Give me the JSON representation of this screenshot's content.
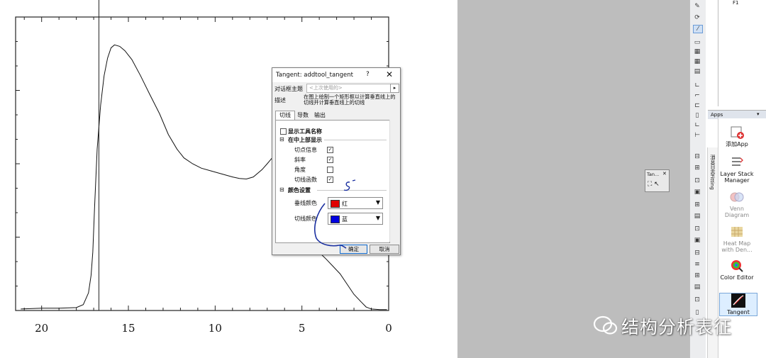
{
  "plot": {
    "x_tick_labels": [
      "20",
      "15",
      "10",
      "5",
      "0"
    ],
    "x_ticks": [
      20,
      15,
      10,
      5,
      0
    ],
    "xlim": [
      21.5,
      0
    ],
    "ylim": [
      0,
      1.0
    ],
    "vertical_line_x": 16.7,
    "curve": [
      [
        21.2,
        0.005
      ],
      [
        20,
        0.008
      ],
      [
        19,
        0.008
      ],
      [
        18,
        0.01
      ],
      [
        17.6,
        0.02
      ],
      [
        17.3,
        0.06
      ],
      [
        17.15,
        0.12
      ],
      [
        17.05,
        0.2
      ],
      [
        16.95,
        0.35
      ],
      [
        16.8,
        0.55
      ],
      [
        16.6,
        0.7
      ],
      [
        16.4,
        0.8
      ],
      [
        16.2,
        0.86
      ],
      [
        16.0,
        0.895
      ],
      [
        15.8,
        0.905
      ],
      [
        15.5,
        0.9
      ],
      [
        15.2,
        0.885
      ],
      [
        14.8,
        0.855
      ],
      [
        14.3,
        0.8
      ],
      [
        13.8,
        0.74
      ],
      [
        13.2,
        0.67
      ],
      [
        12.7,
        0.6
      ],
      [
        12.2,
        0.55
      ],
      [
        11.8,
        0.52
      ],
      [
        11.3,
        0.5
      ],
      [
        10.8,
        0.485
      ],
      [
        10.2,
        0.475
      ],
      [
        9.6,
        0.465
      ],
      [
        9.0,
        0.455
      ],
      [
        8.6,
        0.45
      ],
      [
        8.2,
        0.448
      ],
      [
        7.8,
        0.455
      ],
      [
        7.3,
        0.48
      ],
      [
        7.0,
        0.5
      ],
      [
        6.5,
        0.535
      ],
      [
        6.2,
        0.54
      ]
    ],
    "curve_tail": [
      [
        3.95,
        0.195
      ],
      [
        3.6,
        0.175
      ],
      [
        3.2,
        0.15
      ],
      [
        2.8,
        0.125
      ],
      [
        2.4,
        0.09
      ],
      [
        2.0,
        0.055
      ],
      [
        1.6,
        0.03
      ],
      [
        1.3,
        0.012
      ],
      [
        1.0,
        0.005
      ],
      [
        0.5,
        0.003
      ],
      [
        0.1,
        0.003
      ]
    ]
  },
  "dialog": {
    "title": "Tangent: addtool_tangent",
    "help": "?",
    "close": "✕",
    "theme_label": "对话框主题",
    "theme_value": "<上次使用的>",
    "theme_arrow": "▸",
    "desc_label": "描述",
    "desc_text": "在图上绘制一个矩形框以计算垂直线上的切线并计算垂直线上的切线",
    "tabs": [
      "切线",
      "导数",
      "输出"
    ],
    "show_tool_name": "显示工具名称",
    "group_display": "在中上部显示",
    "group_display_expander": "⊟",
    "options": [
      {
        "label": "切点信息",
        "checked": true
      },
      {
        "label": "斜率",
        "checked": true
      },
      {
        "label": "角度",
        "checked": false
      },
      {
        "label": "切线函数",
        "checked": true
      }
    ],
    "group_color": "颜色设置",
    "group_color_expander": "⊟",
    "vline_color_label": "垂线颜色",
    "vline_color_name": "红",
    "vline_color_hex": "#e00000",
    "tangent_color_label": "切线颜色",
    "tangent_color_name": "蓝",
    "tangent_color_hex": "#0000e0",
    "ok": "确定",
    "cancel": "取消"
  },
  "mini_window": {
    "title": "Tan...",
    "close": "✕",
    "icons": "⛶ ↖"
  },
  "apps": {
    "top_text": "F1",
    "header": "Apps",
    "menu": "▾",
    "side_tab_1": "消息日志",
    "side_tab_2": "Fitting",
    "items": [
      {
        "label": "添加App",
        "icon": "add-app-icon",
        "dim": false
      },
      {
        "label": "Layer Stack Manager",
        "icon": "layer-stack-icon",
        "dim": false
      },
      {
        "label": "Venn Diagram",
        "icon": "venn-icon",
        "dim": true
      },
      {
        "label": "Heat Map with Den...",
        "icon": "heatmap-icon",
        "dim": true
      },
      {
        "label": "Color Editor",
        "icon": "color-editor-icon",
        "dim": false
      },
      {
        "label": "Tangent",
        "icon": "tangent-icon",
        "dim": false
      }
    ]
  },
  "watermark": "结构分析表征",
  "colors": {
    "workspace": "#bdbdbd",
    "annotation": "#1a2fa0"
  }
}
